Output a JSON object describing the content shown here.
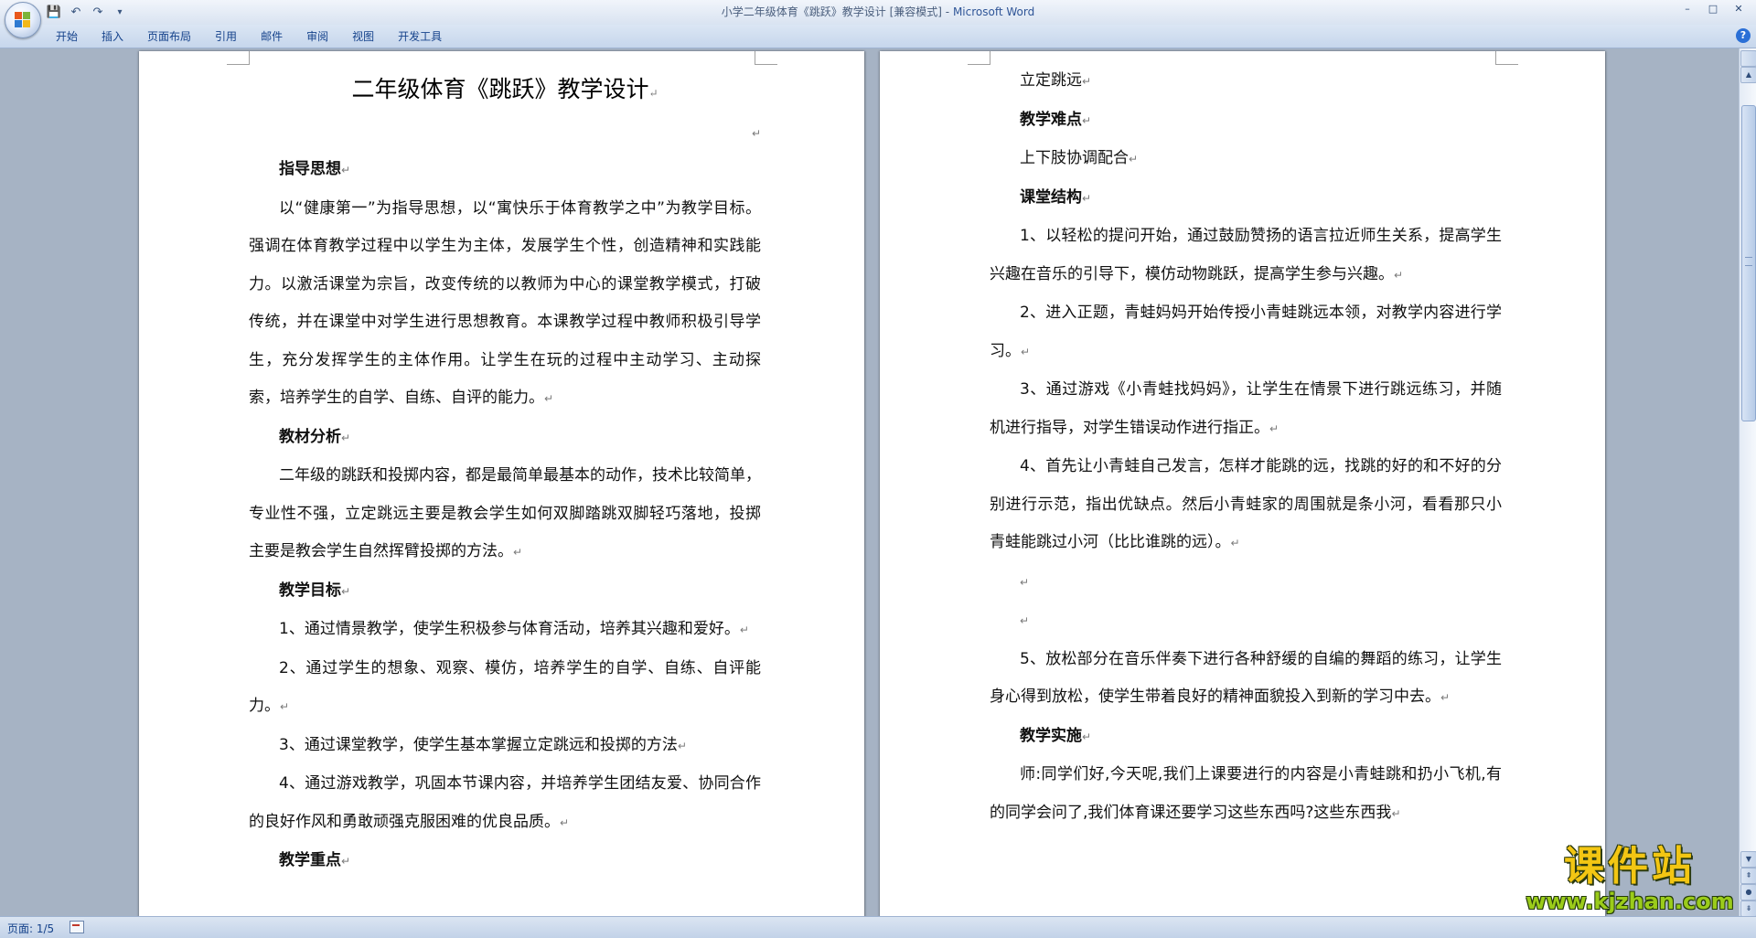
{
  "window": {
    "title_doc": "小学二年级体育《跳跃》教学设计 [兼容模式]",
    "title_sep": " - ",
    "title_app": "Microsoft Word",
    "minimize": "–",
    "maximize": "□",
    "close": "✕"
  },
  "qat": {
    "save_icon": "💾",
    "undo_icon": "↶",
    "redo_icon": "↷",
    "customize_icon": "▾"
  },
  "tabs": [
    "开始",
    "插入",
    "页面布局",
    "引用",
    "邮件",
    "审阅",
    "视图",
    "开发工具"
  ],
  "help": "?",
  "left_page": {
    "title": "二年级体育《跳跃》教学设计",
    "paragraphs": [
      {
        "text": "指导思想",
        "heading": true
      },
      {
        "text": "以“健康第一”为指导思想，以“寓快乐于体育教学之中”为教学目标。强调在体育教学过程中以学生为主体，发展学生个性，创造精神和实践能力。以激活课堂为宗旨，改变传统的以教师为中心的课堂教学模式，打破传统，并在课堂中对学生进行思想教育。本课教学过程中教师积极引导学生，充分发挥学生的主体作用。让学生在玩的过程中主动学习、主动探索，培养学生的自学、自练、自评的能力。",
        "heading": false
      },
      {
        "text": "教材分析",
        "heading": true
      },
      {
        "text": "二年级的跳跃和投掷内容，都是最简单最基本的动作，技术比较简单，专业性不强，立定跳远主要是教会学生如何双脚踏跳双脚轻巧落地，投掷主要是教会学生自然挥臂投掷的方法。",
        "heading": false
      },
      {
        "text": "教学目标",
        "heading": true
      },
      {
        "text": "1、通过情景教学，使学生积极参与体育活动，培养其兴趣和爱好。",
        "heading": false
      },
      {
        "text": "2、通过学生的想象、观察、模仿，培养学生的自学、自练、自评能力。",
        "heading": false
      },
      {
        "text": "3、通过课堂教学，使学生基本掌握立定跳远和投掷的方法",
        "heading": false
      },
      {
        "text": "4、通过游戏教学，巩固本节课内容，并培养学生团结友爱、协同合作的良好作风和勇敢顽强克服困难的优良品质。",
        "heading": false
      },
      {
        "text": "教学重点",
        "heading": true
      }
    ]
  },
  "right_page": {
    "paragraphs": [
      {
        "text": "立定跳远",
        "heading": false
      },
      {
        "text": "教学难点",
        "heading": true
      },
      {
        "text": "上下肢协调配合",
        "heading": false
      },
      {
        "text": "课堂结构",
        "heading": true
      },
      {
        "text": "1、以轻松的提问开始，通过鼓励赞扬的语言拉近师生关系，提高学生兴趣在音乐的引导下，模仿动物跳跃，提高学生参与兴趣。",
        "heading": false
      },
      {
        "text": "2、进入正题，青蛙妈妈开始传授小青蛙跳远本领，对教学内容进行学习。",
        "heading": false
      },
      {
        "text": "3、通过游戏《小青蛙找妈妈》，让学生在情景下进行跳远练习，并随机进行指导，对学生错误动作进行指正。",
        "heading": false
      },
      {
        "text": "4、首先让小青蛙自己发言，怎样才能跳的远，找跳的好的和不好的分别进行示范，指出优缺点。然后小青蛙家的周围就是条小河，看看那只小青蛙能跳过小河（比比谁跳的远）。",
        "heading": false
      },
      {
        "text": "",
        "heading": false
      },
      {
        "text": "",
        "heading": false
      },
      {
        "text": "5、放松部分在音乐伴奏下进行各种舒缓的自编的舞蹈的练习，让学生身心得到放松，使学生带着良好的精神面貌投入到新的学习中去。",
        "heading": false
      },
      {
        "text": "教学实施",
        "heading": true
      },
      {
        "text": "师:同学们好,今天呢,我们上课要进行的内容是小青蛙跳和扔小飞机,有的同学会问了,我们体育课还要学习这些东西吗?这些东西我",
        "heading": false
      }
    ]
  },
  "paragraph_mark": "↵",
  "status": {
    "page": "页面: 1/5"
  },
  "watermark": {
    "main": "课件站",
    "url": "www.kjzhan.com"
  },
  "colors": {
    "title_app": "#2f5597",
    "tab_text": "#15428b",
    "doc_background": "#a6b3c4",
    "watermark_main": "#f3c613",
    "watermark_url": "#9bcc1a"
  }
}
